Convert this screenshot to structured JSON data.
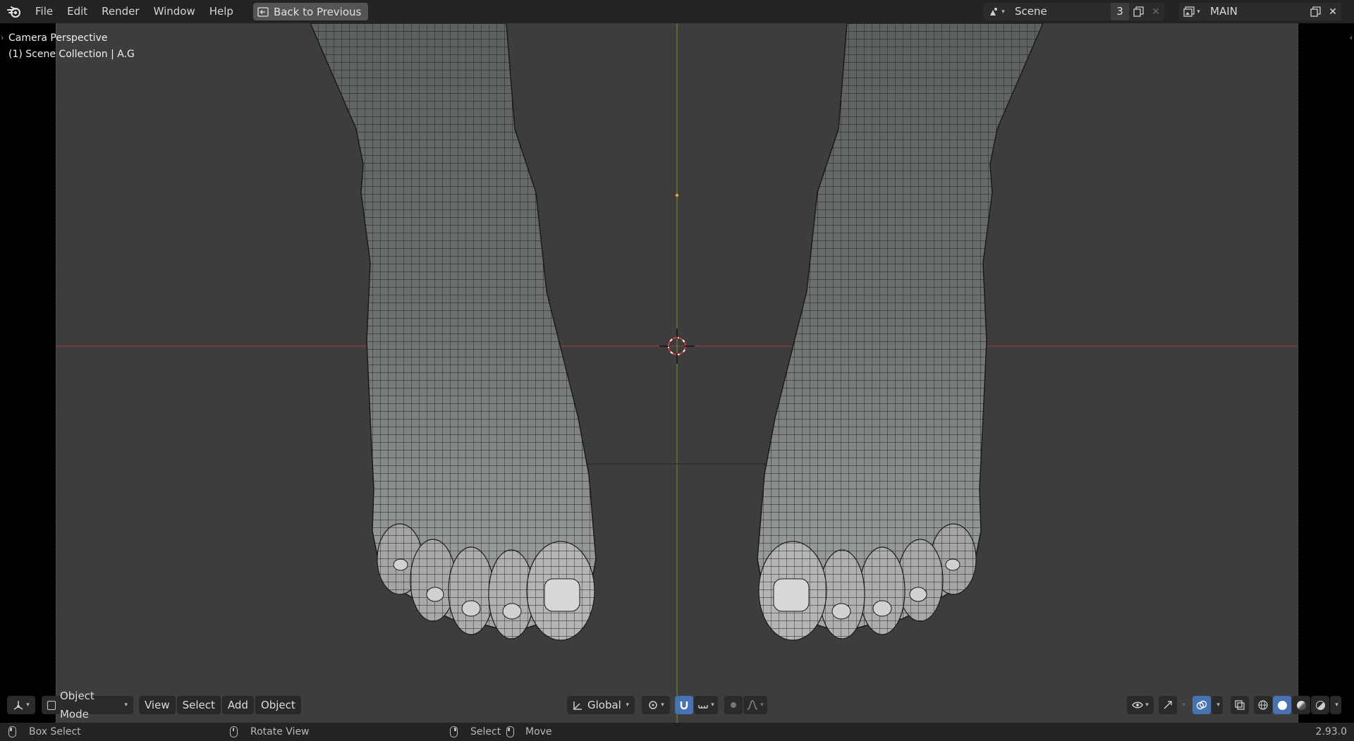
{
  "menu": {
    "items": [
      "File",
      "Edit",
      "Render",
      "Window",
      "Help"
    ],
    "back_button": "Back to Previous"
  },
  "scene": {
    "name": "Scene",
    "count": "3"
  },
  "view_layer": {
    "name": "MAIN"
  },
  "viewport": {
    "perspective_label": "Camera Perspective",
    "collection_label": "(1) Scene Collection | A.G"
  },
  "header": {
    "mode": "Object Mode",
    "menus": [
      "View",
      "Select",
      "Add",
      "Object"
    ],
    "orientation": "Global"
  },
  "status": {
    "box_select": "Box Select",
    "rotate_view": "Rotate View",
    "select": "Select",
    "move": "Move",
    "version": "2.93.0"
  },
  "colors": {
    "accent": "#4772b3",
    "x_axis": "#c0454a",
    "y_axis": "#7a9a3a",
    "background": "#3d3d3d"
  }
}
